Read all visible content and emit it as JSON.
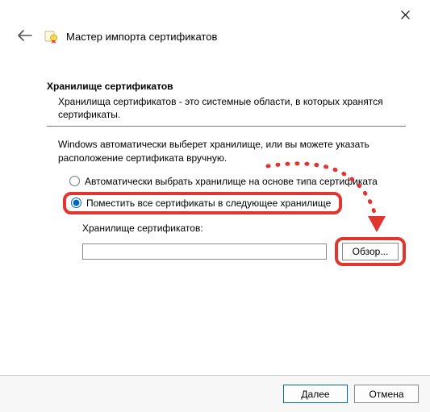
{
  "header": {
    "title": "Мастер импорта сертификатов"
  },
  "section": {
    "heading": "Хранилище сертификатов",
    "desc": "Хранилища сертификатов - это системные области, в которых хранятся сертификаты."
  },
  "instruction": "Windows автоматически выберет хранилище, или вы можете указать расположение сертификата вручную.",
  "radios": {
    "auto": "Автоматически выбрать хранилище на основе типа сертификата",
    "place": "Поместить все сертификаты в следующее хранилище"
  },
  "store": {
    "label": "Хранилище сертификатов:",
    "value": "",
    "browse": "Обзор..."
  },
  "footer": {
    "next": "Далее",
    "cancel": "Отмена"
  }
}
